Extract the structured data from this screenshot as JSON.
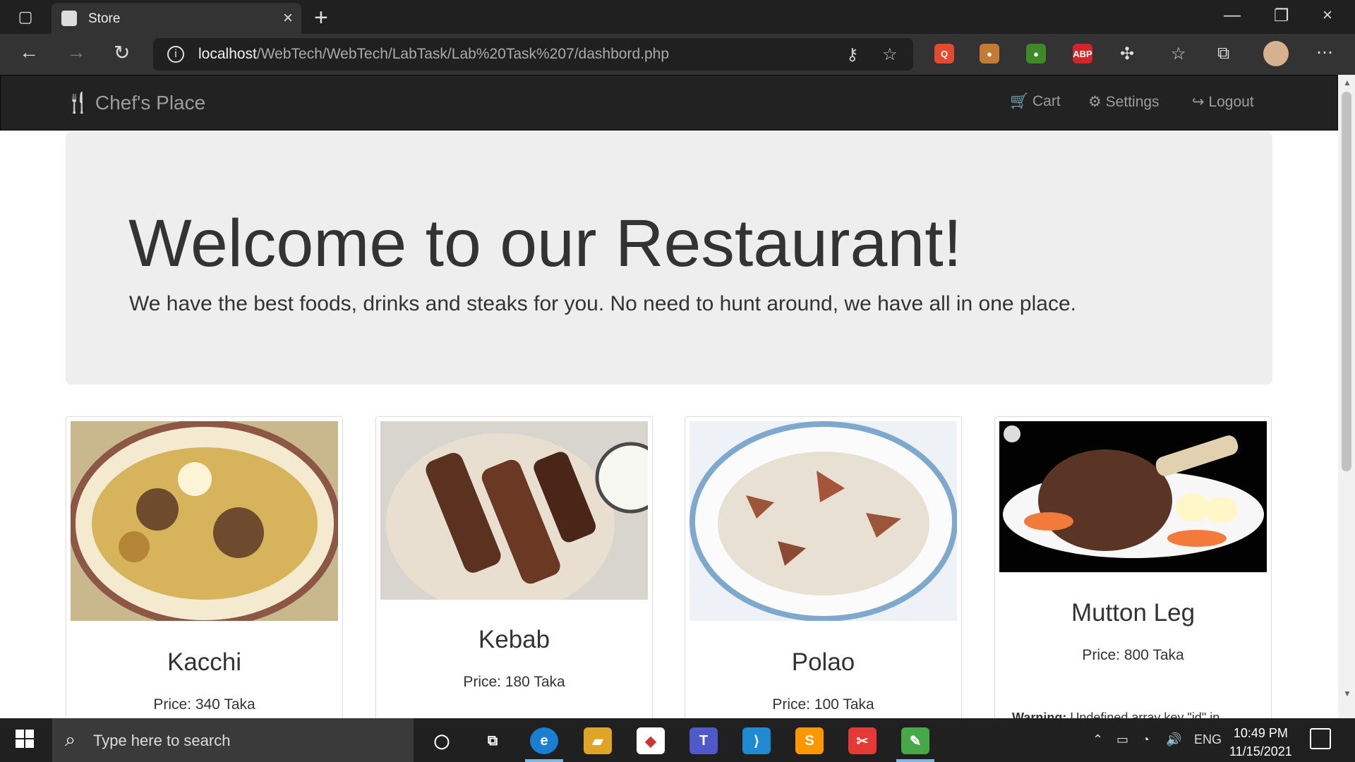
{
  "browser": {
    "tab_title": "Store",
    "url_host": "localhost",
    "url_path": "/WebTech/WebTech/LabTask/Lab%20Task%207/dashbord.php",
    "extensions": [
      {
        "name": "extension-orange",
        "label": "Q",
        "color": "#e44a2d"
      },
      {
        "name": "extension-cookie",
        "label": "●",
        "color": "#c47b35"
      },
      {
        "name": "extension-green",
        "label": "●",
        "color": "#3f8a28"
      },
      {
        "name": "adblock-plus",
        "label": "ABP",
        "color": "#d4242a"
      }
    ]
  },
  "site": {
    "brand": "Chef's Place",
    "nav": {
      "cart": "Cart",
      "settings": "Settings",
      "logout": "Logout"
    },
    "hero": {
      "title": "Welcome to our Restaurant!",
      "subtitle": "We have the best foods, drinks and steaks for you. No need to hunt around, we have all in one place."
    },
    "products": [
      {
        "name": "Kacchi",
        "price": "Price: 340 Taka"
      },
      {
        "name": "Kebab",
        "price": "Price: 180 Taka"
      },
      {
        "name": "Polao",
        "price": "Price: 100 Taka"
      },
      {
        "name": "Mutton Leg",
        "price": "Price: 800 Taka",
        "warning_label": "Warning:",
        "warning_text": " Undefined array key \"id\" in"
      }
    ]
  },
  "taskbar": {
    "search_placeholder": "Type here to search",
    "language": "ENG",
    "time": "10:49 PM",
    "date": "11/15/2021"
  },
  "colors": {
    "chrome_dark": "#202020",
    "nav_dark": "#222222",
    "hero_bg": "#eeeeee"
  }
}
